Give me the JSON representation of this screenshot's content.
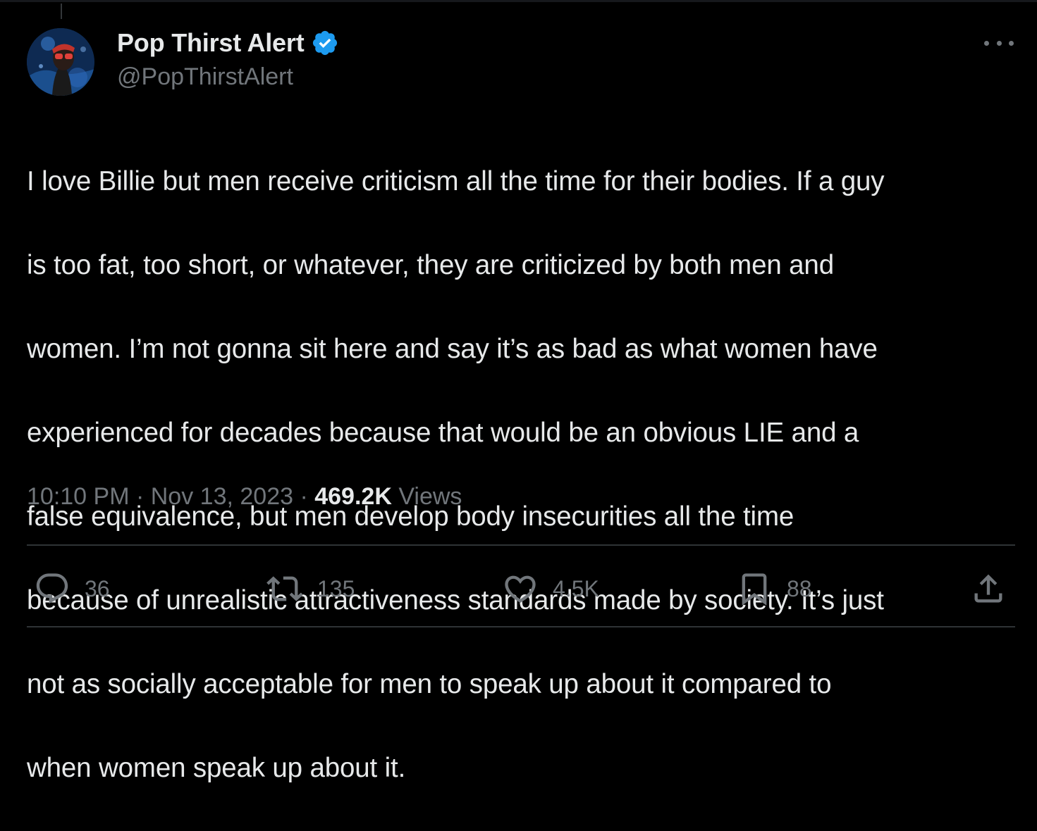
{
  "author": {
    "display_name": "Pop Thirst Alert",
    "handle": "@PopThirstAlert",
    "verified": true,
    "verified_color": "#1d9bf0"
  },
  "tweet": {
    "text_lines": [
      "I love Billie but men receive criticism all the time for their bodies. If a guy",
      "is too fat, too short, or whatever, they are criticized by both men and",
      "women. I’m not gonna sit here and say it’s as bad as what women have",
      "experienced for decades because that would be an obvious LIE and a",
      "false equivalence, but men develop body insecurities all the time",
      "because of unrealistic attractiveness standards made by society. It’s just",
      "not as socially acceptable for men to speak up about it compared to",
      "when women speak up about it."
    ],
    "time": "10:10 PM",
    "separator": " · ",
    "date": "Nov 13, 2023",
    "views_count": "469.2K",
    "views_label": " Views"
  },
  "actions": {
    "replies": {
      "icon": "reply-icon",
      "count": "36"
    },
    "retweets": {
      "icon": "retweet-icon",
      "count": "135"
    },
    "likes": {
      "icon": "heart-icon",
      "count": "4.5K"
    },
    "bookmarks": {
      "icon": "bookmark-icon",
      "count": "88"
    },
    "share": {
      "icon": "share-icon"
    }
  },
  "colors": {
    "background": "#000000",
    "text": "#e7e9ea",
    "secondary": "#71767b",
    "divider": "#2f3336"
  }
}
